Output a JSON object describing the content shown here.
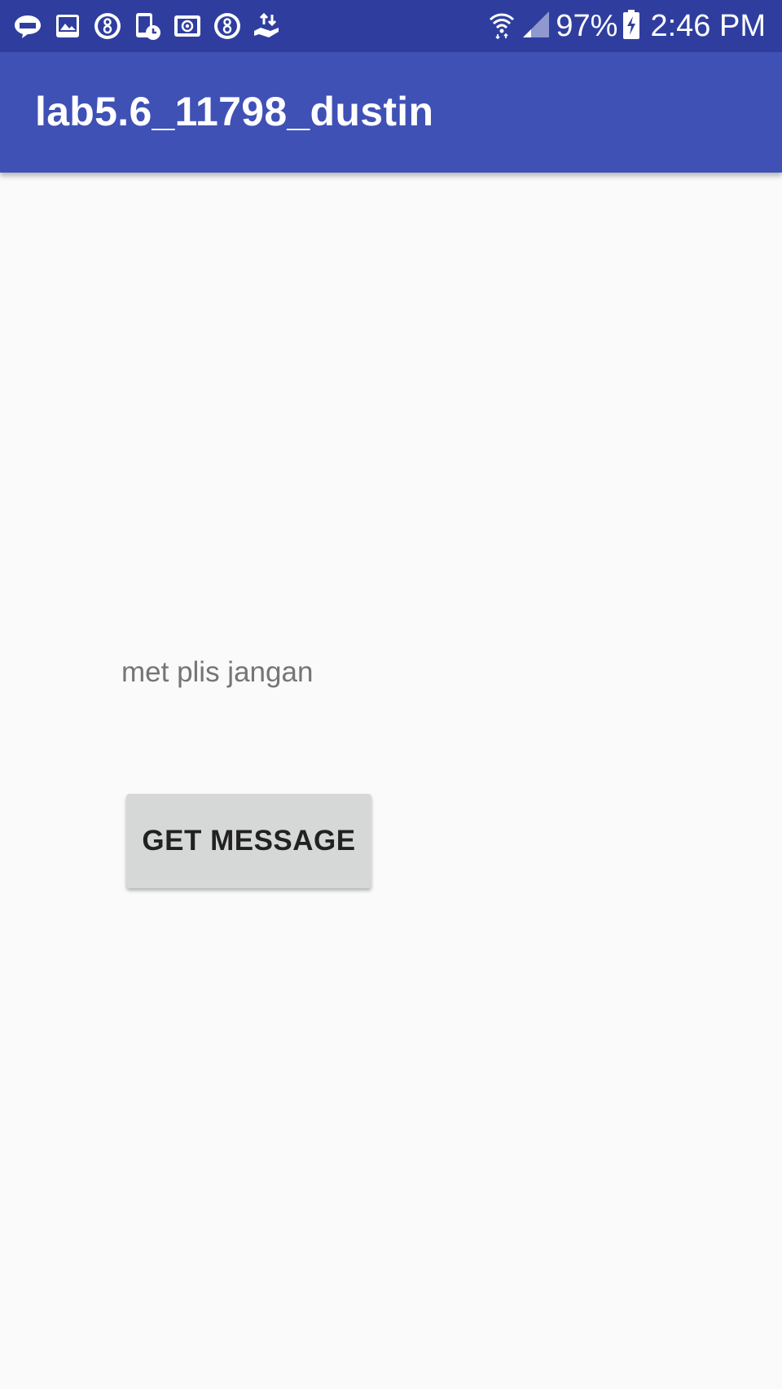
{
  "status_bar": {
    "notification_icons": [
      "line-app-icon",
      "image-icon",
      "circled-8-icon",
      "phone-clock-icon",
      "screencast-at-icon",
      "circled-8-icon",
      "hand-transfer-icon"
    ],
    "battery_text": "97%",
    "time": "2:46 PM"
  },
  "app_bar": {
    "title": "lab5.6_11798_dustin"
  },
  "main": {
    "message_text": "met plis jangan",
    "button_label": "GET MESSAGE"
  },
  "colors": {
    "status_bar_bg": "#2f3e9e",
    "app_bar_bg": "#3f51b5",
    "background": "#fafafa",
    "button_bg": "#d6d7d7",
    "message_text": "#757575"
  }
}
